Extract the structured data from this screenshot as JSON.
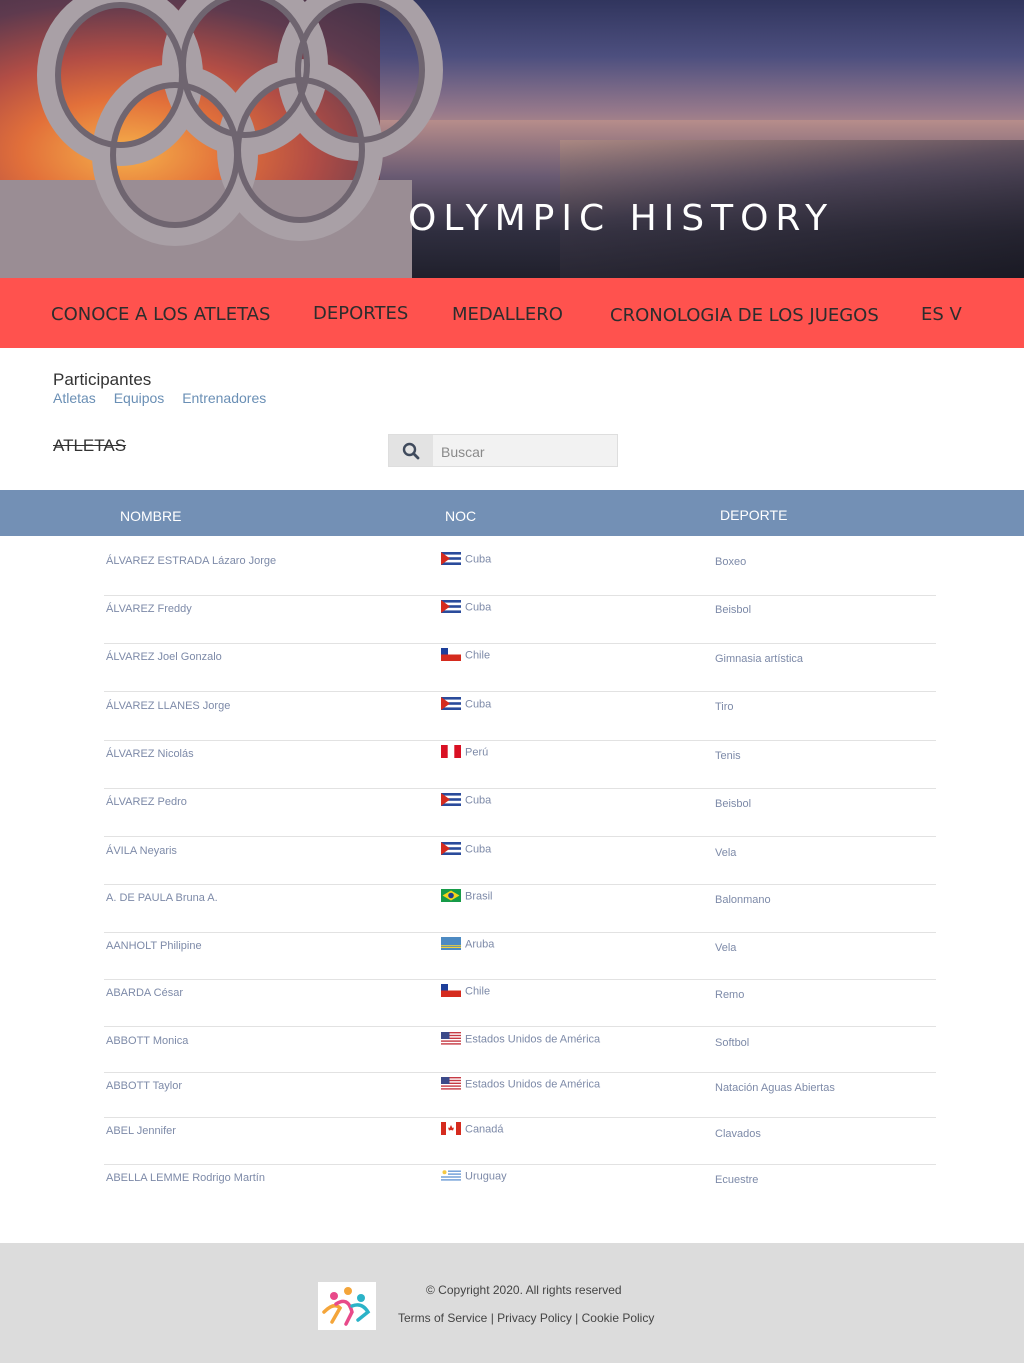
{
  "hero": {
    "title": "OLYMPIC HISTORY"
  },
  "nav": {
    "items": [
      {
        "label": "CONOCE A LOS ATLETAS"
      },
      {
        "label": "DEPORTES"
      },
      {
        "label": "MEDALLERO"
      },
      {
        "label": "CRONOLOGIA DE LOS JUEGOS"
      },
      {
        "label": "ES V"
      }
    ]
  },
  "participants": {
    "title": "Participantes",
    "links": [
      "Atletas",
      "Equipos",
      "Entrenadores"
    ]
  },
  "section": {
    "title": "ATLETAS"
  },
  "search": {
    "placeholder": "Buscar",
    "icon": "search-icon"
  },
  "table": {
    "headers": [
      "NOMBRE",
      "NOC",
      "DEPORTE"
    ],
    "rows": [
      {
        "name": "ÁLVAREZ ESTRADA Lázaro Jorge",
        "noc": "Cuba",
        "flag": "cuba",
        "sport": "Boxeo"
      },
      {
        "name": "ÁLVAREZ Freddy",
        "noc": "Cuba",
        "flag": "cuba",
        "sport": "Beisbol"
      },
      {
        "name": "ÁLVAREZ Joel Gonzalo",
        "noc": "Chile",
        "flag": "chile",
        "sport": "Gimnasia artística"
      },
      {
        "name": "ÁLVAREZ LLANES Jorge",
        "noc": "Cuba",
        "flag": "cuba",
        "sport": "Tiro"
      },
      {
        "name": "ÁLVAREZ Nicolás",
        "noc": "Perú",
        "flag": "peru",
        "sport": "Tenis"
      },
      {
        "name": "ÁLVAREZ Pedro",
        "noc": "Cuba",
        "flag": "cuba",
        "sport": "Beisbol"
      },
      {
        "name": "ÁVILA Neyaris",
        "noc": "Cuba",
        "flag": "cuba",
        "sport": "Vela"
      },
      {
        "name": "A. DE PAULA Bruna A.",
        "noc": "Brasil",
        "flag": "brasil",
        "sport": "Balonmano"
      },
      {
        "name": "AANHOLT Philipine",
        "noc": "Aruba",
        "flag": "aruba",
        "sport": "Vela"
      },
      {
        "name": "ABARDA César",
        "noc": "Chile",
        "flag": "chile",
        "sport": "Remo"
      },
      {
        "name": "ABBOTT Monica",
        "noc": "Estados Unidos de América",
        "flag": "usa",
        "sport": "Softbol"
      },
      {
        "name": "ABBOTT Taylor",
        "noc": "Estados Unidos de América",
        "flag": "usa",
        "sport": "Natación Aguas Abiertas"
      },
      {
        "name": "ABEL Jennifer",
        "noc": "Canadá",
        "flag": "canada",
        "sport": "Clavados"
      },
      {
        "name": "ABELLA LEMME Rodrigo Martín",
        "noc": "Uruguay",
        "flag": "uruguay",
        "sport": "Ecuestre"
      }
    ]
  },
  "footer": {
    "copyright": "© Copyright 2020. All rights reserved",
    "links": [
      "Terms of Service",
      "Privacy Policy",
      "Cookie Policy"
    ]
  }
}
